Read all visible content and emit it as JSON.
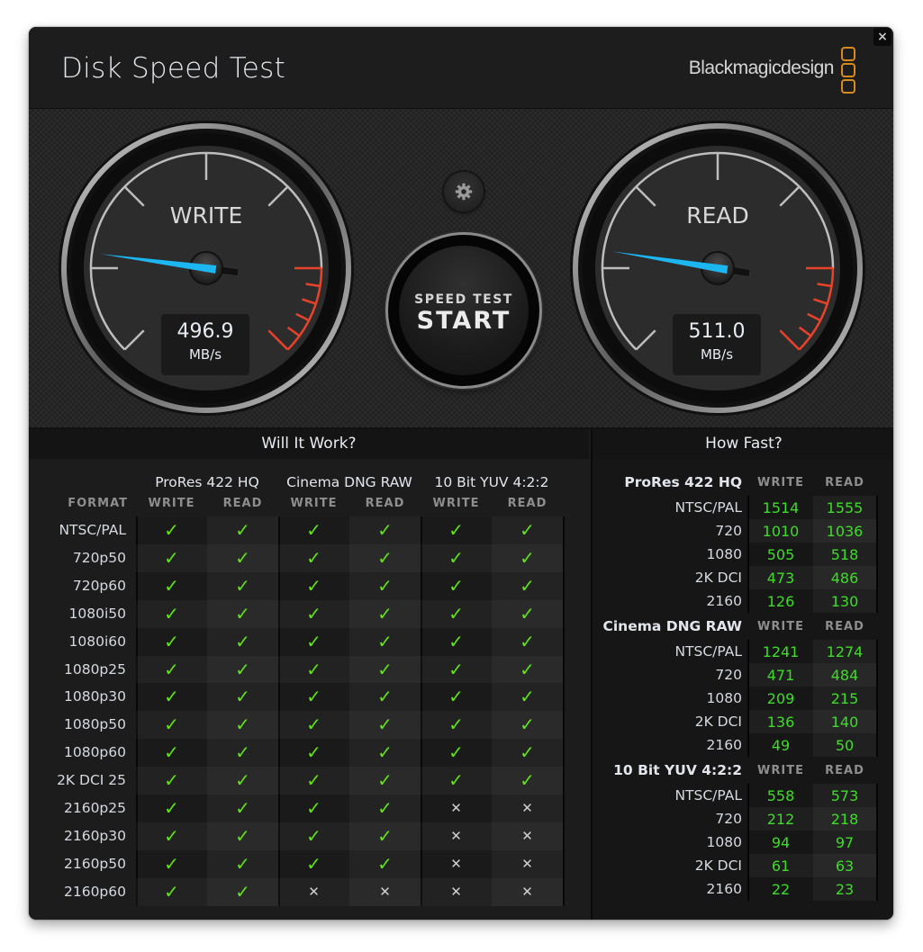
{
  "window": {
    "title": "Disk Speed Test",
    "brand": "Blackmagicdesign",
    "close_label": "×",
    "accent_needle": "#1cb6f0",
    "accent_redline": "#e8432a",
    "brand_color": "#d88a1c",
    "ok_color": "#61e21a"
  },
  "gauges": {
    "write": {
      "label": "WRITE",
      "value": "496.9",
      "unit": "MB/s",
      "needle_fraction": 0.195
    },
    "read": {
      "label": "READ",
      "value": "511.0",
      "unit": "MB/s",
      "needle_fraction": 0.2
    }
  },
  "controls": {
    "settings_icon": "gear-icon",
    "start_sub": "SPEED TEST",
    "start_main": "START"
  },
  "will_it_work": {
    "title": "Will It Work?",
    "format_header": "FORMAT",
    "groups": [
      "ProRes 422 HQ",
      "Cinema DNG RAW",
      "10 Bit YUV 4:2:2"
    ],
    "subcols": [
      "WRITE",
      "READ",
      "WRITE",
      "READ",
      "WRITE",
      "READ"
    ],
    "rows": [
      {
        "format": "NTSC/PAL",
        "results": [
          true,
          true,
          true,
          true,
          true,
          true
        ]
      },
      {
        "format": "720p50",
        "results": [
          true,
          true,
          true,
          true,
          true,
          true
        ]
      },
      {
        "format": "720p60",
        "results": [
          true,
          true,
          true,
          true,
          true,
          true
        ]
      },
      {
        "format": "1080i50",
        "results": [
          true,
          true,
          true,
          true,
          true,
          true
        ]
      },
      {
        "format": "1080i60",
        "results": [
          true,
          true,
          true,
          true,
          true,
          true
        ]
      },
      {
        "format": "1080p25",
        "results": [
          true,
          true,
          true,
          true,
          true,
          true
        ]
      },
      {
        "format": "1080p30",
        "results": [
          true,
          true,
          true,
          true,
          true,
          true
        ]
      },
      {
        "format": "1080p50",
        "results": [
          true,
          true,
          true,
          true,
          true,
          true
        ]
      },
      {
        "format": "1080p60",
        "results": [
          true,
          true,
          true,
          true,
          true,
          true
        ]
      },
      {
        "format": "2K DCI 25",
        "results": [
          true,
          true,
          true,
          true,
          true,
          true
        ]
      },
      {
        "format": "2160p25",
        "results": [
          true,
          true,
          true,
          true,
          false,
          false
        ]
      },
      {
        "format": "2160p30",
        "results": [
          true,
          true,
          true,
          true,
          false,
          false
        ]
      },
      {
        "format": "2160p50",
        "results": [
          true,
          true,
          true,
          true,
          false,
          false
        ]
      },
      {
        "format": "2160p60",
        "results": [
          true,
          true,
          false,
          false,
          false,
          false
        ]
      }
    ],
    "ok_glyph": "✓",
    "fail_glyph": "✕"
  },
  "how_fast": {
    "title": "How Fast?",
    "write_header": "WRITE",
    "read_header": "READ",
    "groups": [
      {
        "name": "ProRes 422 HQ",
        "rows": [
          {
            "label": "NTSC/PAL",
            "write": "1514",
            "read": "1555"
          },
          {
            "label": "720",
            "write": "1010",
            "read": "1036"
          },
          {
            "label": "1080",
            "write": "505",
            "read": "518"
          },
          {
            "label": "2K DCI",
            "write": "473",
            "read": "486"
          },
          {
            "label": "2160",
            "write": "126",
            "read": "130"
          }
        ]
      },
      {
        "name": "Cinema DNG RAW",
        "rows": [
          {
            "label": "NTSC/PAL",
            "write": "1241",
            "read": "1274"
          },
          {
            "label": "720",
            "write": "471",
            "read": "484"
          },
          {
            "label": "1080",
            "write": "209",
            "read": "215"
          },
          {
            "label": "2K DCI",
            "write": "136",
            "read": "140"
          },
          {
            "label": "2160",
            "write": "49",
            "read": "50"
          }
        ]
      },
      {
        "name": "10 Bit YUV 4:2:2",
        "rows": [
          {
            "label": "NTSC/PAL",
            "write": "558",
            "read": "573"
          },
          {
            "label": "720",
            "write": "212",
            "read": "218"
          },
          {
            "label": "1080",
            "write": "94",
            "read": "97"
          },
          {
            "label": "2K DCI",
            "write": "61",
            "read": "63"
          },
          {
            "label": "2160",
            "write": "22",
            "read": "23"
          }
        ]
      }
    ]
  }
}
